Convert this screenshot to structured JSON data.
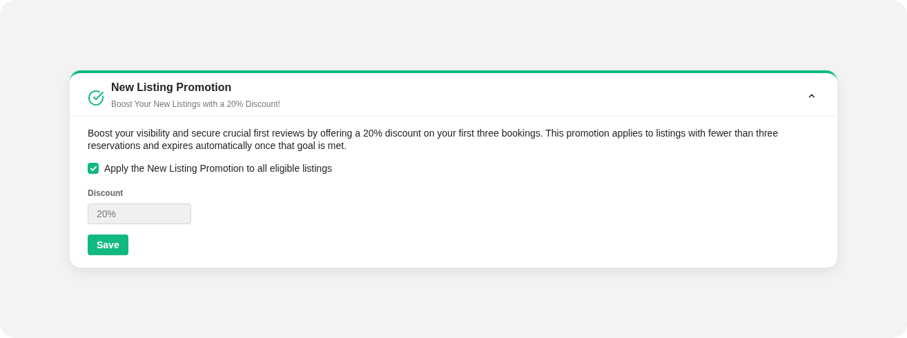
{
  "promotion": {
    "title": "New Listing Promotion",
    "subtitle": "Boost Your New Listings with a 20% Discount!",
    "expanded": true,
    "description": "Boost your visibility and secure crucial first reviews by offering a 20% discount on your first three bookings. This promotion applies to listings with fewer than three reservations and expires automatically once that goal is met.",
    "apply_checkbox": {
      "label": "Apply the New Listing Promotion to all eligible listings",
      "checked": true
    },
    "discount_field": {
      "label": "Discount",
      "value": "20%",
      "disabled": true
    },
    "save_button": "Save"
  }
}
